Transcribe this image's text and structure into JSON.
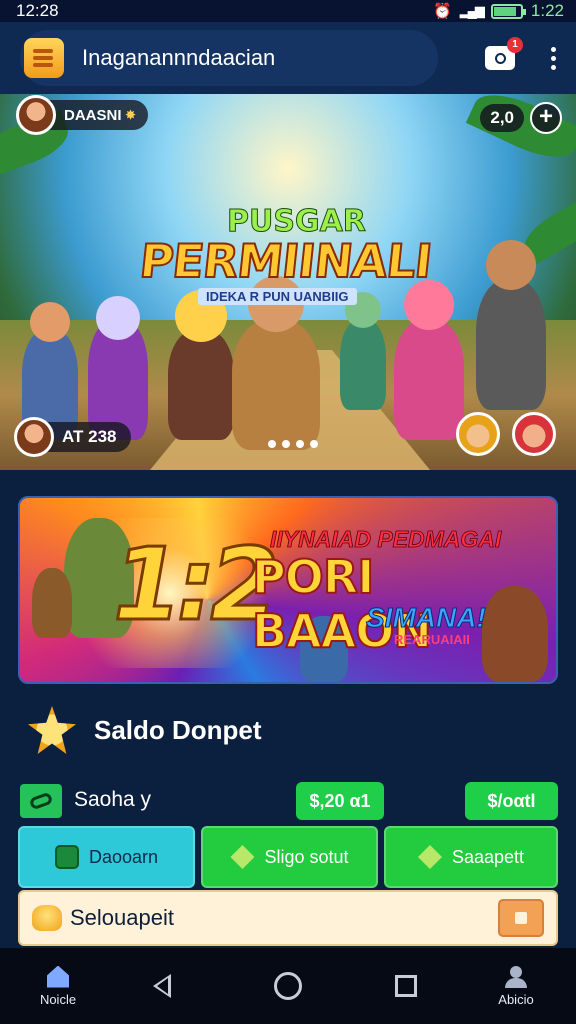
{
  "status_bar": {
    "time": "12:28",
    "clock": "1:22",
    "battery_level": 0.85
  },
  "app_bar": {
    "title": "Inaganannndaacian",
    "notification_count": "1"
  },
  "hero": {
    "player_name": "DAASNI",
    "counter": "2,0",
    "title_top": "PUSGAR",
    "title_main": "PERMIINALI",
    "subtitle": "IDEKA R PUN UANBIIG",
    "score": "AT 238",
    "carousel_pages": 4
  },
  "promo": {
    "number": "1:2",
    "line1": "IIYNAIAD PEDMAGAI",
    "line2": "PORI BAAON",
    "line3": "SIMANA!",
    "line4": "REARUAIAII"
  },
  "wallet": {
    "title": "Saldo Donpet",
    "saldo_label": "Saoha y",
    "saldo_value": "$,20 α1",
    "saldo_value_2": "$/oαtl"
  },
  "actions": [
    {
      "label": "Daooarn"
    },
    {
      "label": "Sligo sotut"
    },
    {
      "label": "Saaapett"
    }
  ],
  "secondary": {
    "label": "Selouapeit"
  },
  "bottom_nav": {
    "home_label": "Noicle",
    "profile_label": "Abicio"
  },
  "colors": {
    "background": "#0b1f3f",
    "accent_green": "#22cc3e",
    "accent_cyan": "#2ec9d8",
    "badge_red": "#e8303a"
  }
}
